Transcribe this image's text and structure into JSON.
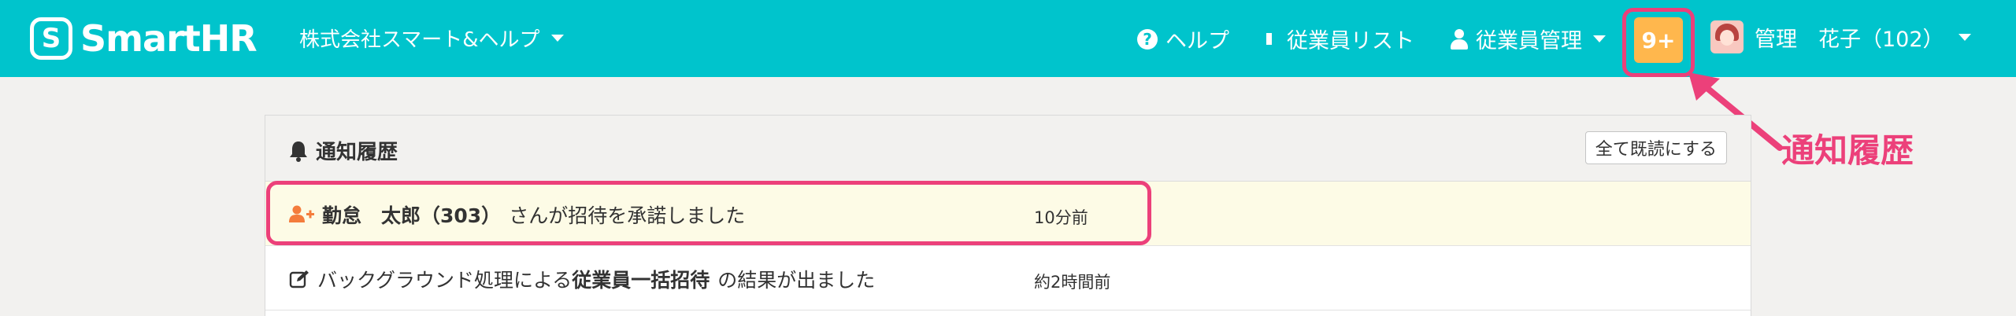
{
  "header": {
    "logo_text": "SmartHR",
    "company_name": "株式会社スマート&ヘルプ",
    "help_label": "ヘルプ",
    "employee_list_label": "従業員リスト",
    "employee_management_label": "従業員管理",
    "notification_count": "9+",
    "user_name": "管理　花子（102）"
  },
  "annotation": {
    "label": "通知履歴",
    "color": "#ec407a"
  },
  "panel": {
    "title": "通知履歴",
    "mark_all_read_label": "全て既読にする"
  },
  "notifications": [
    {
      "name_bold": "勤怠　太郎（303）",
      "text": "さんが招待を承諾しました",
      "time": "10分前",
      "icon": "user-plus-icon",
      "unread": true
    },
    {
      "prefix": "バックグラウンド処理による",
      "bold": "従業員一括招待",
      "suffix": "の結果が出ました",
      "time": "約2時間前",
      "icon": "edit-icon",
      "unread": false
    }
  ],
  "colors": {
    "header_bg": "#00c4cc",
    "badge_bg": "#ffb74d",
    "highlight": "#ec407a",
    "accept_icon": "#f47c3c"
  }
}
